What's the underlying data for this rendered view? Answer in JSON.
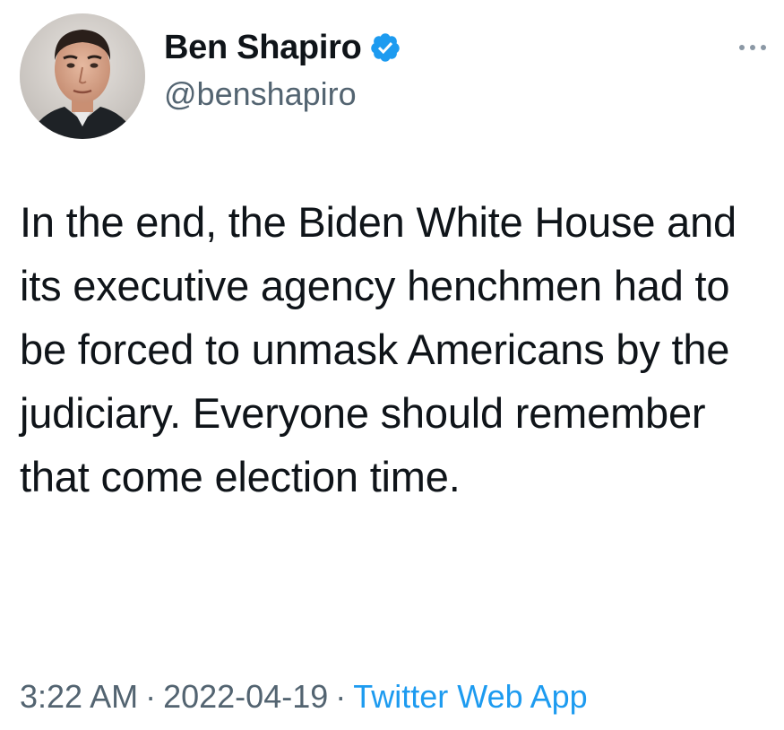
{
  "author": {
    "display_name": "Ben Shapiro",
    "handle": "@benshapiro",
    "verified": true,
    "avatar_icon": "profile-photo"
  },
  "menu": {
    "icon": "more-dots-icon"
  },
  "tweet": {
    "text": "In the end, the Biden White House and its executive agency henchmen had to be forced to unmask Americans by the judiciary. Everyone should remember that come election time."
  },
  "meta": {
    "time": "3:22 AM",
    "separator": "·",
    "date": "2022-04-19",
    "source": "Twitter Web App"
  },
  "colors": {
    "verified_blue": "#1d9bf0",
    "link_blue": "#1d9bf0",
    "secondary_text": "#536471",
    "primary_text": "#0f1419"
  }
}
